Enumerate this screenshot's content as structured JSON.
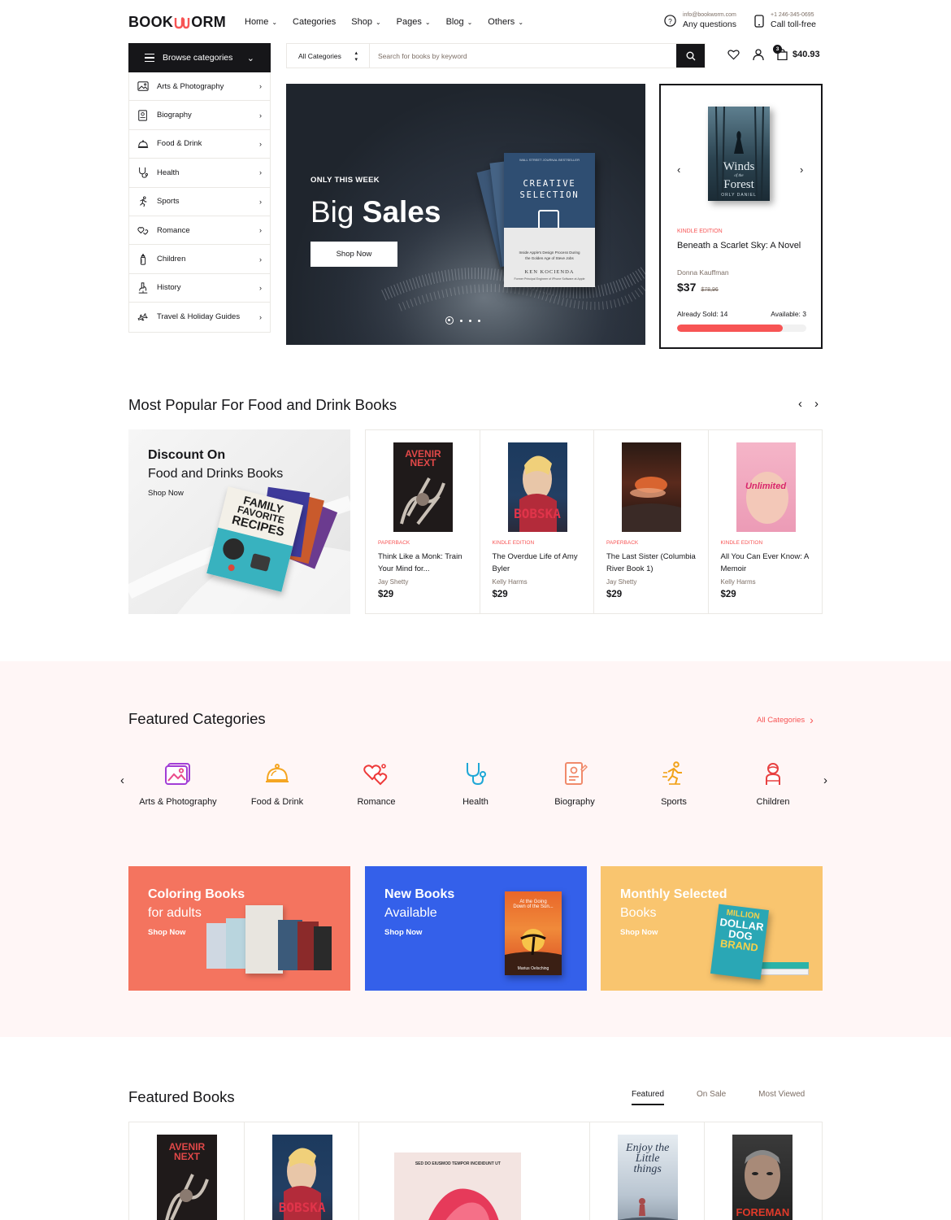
{
  "header": {
    "logo": {
      "left": "BOOK",
      "right": "ORM"
    },
    "nav": [
      "Home",
      "Categories",
      "Shop",
      "Pages",
      "Blog",
      "Others"
    ],
    "nav_has_caret": [
      true,
      false,
      true,
      true,
      true,
      true
    ],
    "contact_email": "info@bookworm.com",
    "contact_question": "Any questions",
    "contact_phone": "+1 246-345-0695",
    "contact_call": "Call toll-free",
    "cart_count": "3",
    "cart_total": "$40.93"
  },
  "browse": {
    "label": "Browse categories",
    "items": [
      "Arts & Photography",
      "Biography",
      "Food & Drink",
      "Health",
      "Sports",
      "Romance",
      "Children",
      "History",
      "Travel & Holiday Guides"
    ]
  },
  "search": {
    "category": "All Categories",
    "placeholder": "Search for books by keyword"
  },
  "hero": {
    "tag": "ONLY THIS WEEK",
    "title_light": "Big",
    "title_bold": "Sales",
    "button": "Shop Now",
    "book_tag": "WALL STREET JOURNAL BESTSELLER",
    "book_title_1": "CREATIVE",
    "book_title_2": "SELECTION",
    "book_sub_1": "Inside Apple's Design Process During",
    "book_sub_2": "the Golden Age of Steve Jobs",
    "book_author": "KEN KOCIENDA",
    "book_author_sub": "Former Principal Engineer of iPhone Software at Apple"
  },
  "deal": {
    "cover_title_1": "Winds",
    "cover_title_2": "of the",
    "cover_title_3": "Forest",
    "cover_author": "ORLY DANIEL",
    "kind": "KINDLE EDITION",
    "name": "Beneath a Scarlet Sky: A Novel",
    "author": "Donna Kauffman",
    "price": "$37",
    "old_price": "$78,96",
    "sold": "Already Sold: 14",
    "available": "Available: 3",
    "progress": 0.82
  },
  "popular": {
    "title": "Most Popular For Food and Drink Books",
    "promo_1": "Discount On",
    "promo_2": "Food and Drinks Books",
    "promo_3": "Shop Now",
    "promo_book_1": "FAMILY",
    "promo_book_2": "FAVORITE",
    "promo_book_3": "RECIPES",
    "books": [
      {
        "kind": "PAPERBACK",
        "name": "Think Like a Monk: Train Your Mind for...",
        "author": "Jay Shetty",
        "price": "$29",
        "cover_a": "AVENIR",
        "cover_b": "NEXT"
      },
      {
        "kind": "KINDLE EDITION",
        "name": "The Overdue Life of Amy Byler",
        "author": "Kelly Harms",
        "price": "$29",
        "cover_a": "BOBSKA",
        "cover_b": ""
      },
      {
        "kind": "PAPERBACK",
        "name": "The Last Sister (Columbia River Book 1)",
        "author": "Jay Shetty",
        "price": "$29",
        "cover_a": "",
        "cover_b": ""
      },
      {
        "kind": "KINDLE EDITION",
        "name": "All You Can Ever Know: A Memoir",
        "author": "Kelly Harms",
        "price": "$29",
        "cover_a": "Unlimited",
        "cover_b": ""
      }
    ]
  },
  "featured_categories": {
    "title": "Featured Categories",
    "all": "All Categories",
    "items": [
      "Arts & Photography",
      "Food & Drink",
      "Romance",
      "Health",
      "Biography",
      "Sports",
      "Children"
    ]
  },
  "tiles": [
    {
      "a": "Coloring Books",
      "b": "for adults",
      "c": "Shop Now",
      "color": "#f4745f"
    },
    {
      "a": "New Books",
      "b": "Available",
      "c": "Shop Now",
      "color": "#3460ea",
      "cover_1": "At the Going",
      "cover_2": "Down of the Sun...",
      "cover_3": "Marius Oelsching"
    },
    {
      "a": "Monthly Selected",
      "b": "Books",
      "c": "Shop Now",
      "color": "#f9c56f",
      "cover_1": "MILLION",
      "cover_2": "DOLLAR",
      "cover_3": "DOG",
      "cover_4": "BRAND"
    }
  ],
  "featured_books": {
    "title": "Featured Books",
    "tabs": [
      "Featured",
      "On Sale",
      "Most Viewed"
    ],
    "covers": [
      "AVENIR NEXT",
      "BOBSKA",
      "SED DO EIUSMOD TEMPOR INCIDIDUNT UT",
      "Enjoy the Little things",
      "FOREMAN"
    ]
  },
  "colors": {
    "accent": "#f75454",
    "dark": "#161619",
    "muted": "#7c6e65",
    "border": "#eae8e4",
    "band": "#fff6f6"
  }
}
